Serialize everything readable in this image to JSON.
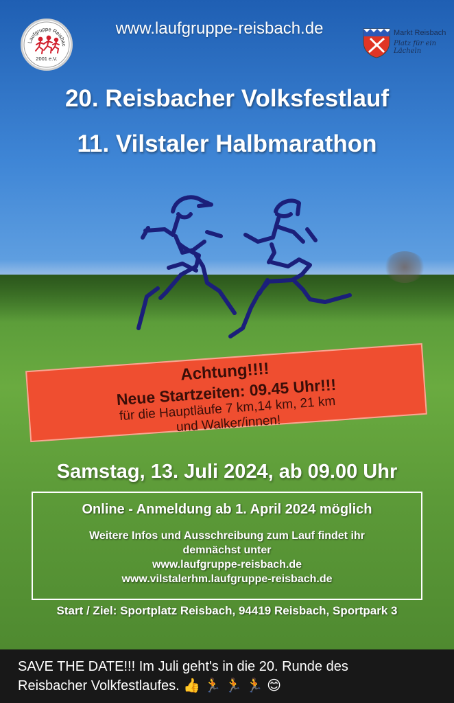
{
  "poster": {
    "website": "www.laufgruppe-reisbach.de",
    "logo_left": {
      "top_text": "Laufgruppe Reisbach",
      "bottom_text": "2001 e.V."
    },
    "logo_right": {
      "title": "Markt Reisbach",
      "slogan": "Platz für ein Lächeln",
      "colors": {
        "red": "#e03524",
        "blue": "#2b58b8"
      }
    },
    "title_1": "20. Reisbacher Volksfestlauf",
    "title_2": "11. Vilstaler Halbmarathon",
    "notice": {
      "headline": "Achtung!!!!",
      "times": "Neue Startzeiten: 09.45 Uhr!!!",
      "line1": "für die Hauptläufe 7 km,14 km, 21 km",
      "line2": "und Walker/innen!",
      "bg_color": "#ef4e30"
    },
    "date": "Samstag, 13. Juli 2024, ab 09.00 Uhr",
    "info": {
      "headline": "Online - Anmeldung ab 1. April 2024 möglich",
      "line1": "Weitere Infos und Ausschreibung zum Lauf findet ihr",
      "line2": "demnächst unter",
      "link1": "www.laufgruppe-reisbach.de",
      "link2": "www.vilstalerhm.laufgruppe-reisbach.de"
    },
    "start": "Start / Ziel: Sportplatz Reisbach, 94419 Reisbach, Sportpark 3"
  },
  "caption": {
    "line1": "SAVE THE DATE!!! Im Juli geht's in die 20. Runde des",
    "line2": "Reisbacher Volkfestlaufes.",
    "emojis": [
      "thumbs-up",
      "runner",
      "runner",
      "runner",
      "smiling-face"
    ]
  }
}
